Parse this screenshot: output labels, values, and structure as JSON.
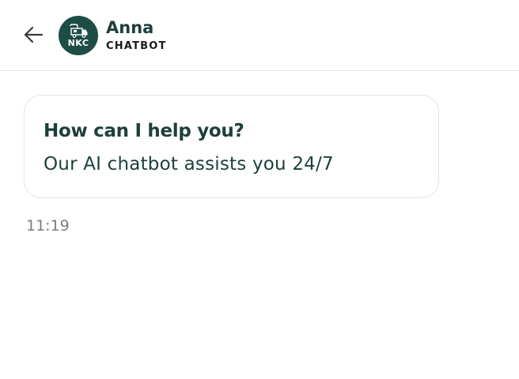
{
  "header": {
    "back_icon": "arrow-left-icon",
    "avatar": {
      "logo_icon": "food-truck-icon",
      "logo_text": "NKC",
      "color": "#1d4d45"
    },
    "agent_name": "Anna",
    "agent_role": "CHATBOT"
  },
  "conversation": {
    "messages": [
      {
        "title": "How can I help you?",
        "body": "Our AI chatbot assists you 24/7",
        "time": "11:19"
      }
    ]
  },
  "colors": {
    "text_primary": "#1d3f3a",
    "timestamp": "#7d7d7d",
    "border": "#e3e3e3"
  }
}
